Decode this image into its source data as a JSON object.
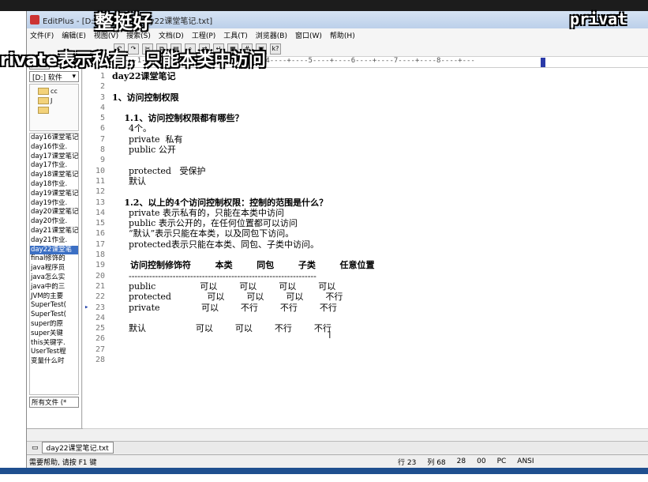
{
  "window": {
    "title": "EditPlus - [D:\\Document\\day22课堂笔记.txt]"
  },
  "menubar": [
    "文件(F)",
    "编辑(E)",
    "视图(V)",
    "搜索(S)",
    "文档(D)",
    "工程(P)",
    "工具(T)",
    "浏览器(B)",
    "窗口(W)",
    "帮助(H)"
  ],
  "toolbar": {
    "help_label": "k?"
  },
  "sidebar": {
    "tab_label": "目录",
    "drive": "[D:] 软件",
    "folders": [
      "cc",
      "J",
      ""
    ],
    "files": [
      {
        "name": "day16课堂笔记"
      },
      {
        "name": "day16作业."
      },
      {
        "name": "day17课堂笔记"
      },
      {
        "name": "day17作业."
      },
      {
        "name": "day18课堂笔记"
      },
      {
        "name": "day18作业."
      },
      {
        "name": "day19课堂笔记"
      },
      {
        "name": "day19作业."
      },
      {
        "name": "day20课堂笔记"
      },
      {
        "name": "day20作业."
      },
      {
        "name": "day21课堂笔记"
      },
      {
        "name": "day21作业."
      },
      {
        "name": "day22课堂笔"
      },
      {
        "name": "final修饰的"
      },
      {
        "name": "java程序员"
      },
      {
        "name": "java怎么实"
      },
      {
        "name": "java中的三"
      },
      {
        "name": "JVM的主要"
      },
      {
        "name": "SuperTest("
      },
      {
        "name": "SuperTest("
      },
      {
        "name": "super的原"
      },
      {
        "name": "super关键"
      },
      {
        "name": "this关键字."
      },
      {
        "name": "UserTest程"
      },
      {
        "name": "变量什么时"
      }
    ],
    "selected_index": 12,
    "filter": "所有文件 (*"
  },
  "ruler": "----+----1----+----2----+----3----+----4----+----5----+----6----+----7----+----8----+---",
  "lines": [
    "day22课堂笔记",
    "",
    "1、访问控制权限",
    "",
    "    1.1、访问控制权限都有哪些？",
    "      4个。",
    "      private  私有",
    "      public 公开",
    "",
    "      protected   受保护",
    "      默认",
    "",
    "    1.2、以上的4个访问控制权限：控制的范围是什么？",
    "      private 表示私有的，只能在本类中访问",
    "      public 表示公开的，在任何位置都可以访问",
    "      “默认”表示只能在本类，以及同包下访问。",
    "      protected表示只能在本类、同包、子类中访问。",
    "",
    "      访问控制修饰符        本类        同包        子类        任意位置",
    "      ----------------------------------------------------------------",
    "      public                可以        可以        可以        可以",
    "      protected             可以        可以        可以        不行",
    "      private               可以        不行        不行        不行",
    "",
    "      默认                  可以        可以        不行        不行",
    "",
    "",
    ""
  ],
  "current_line": 23,
  "doc_tab": "day22课堂笔记.txt",
  "status": {
    "help": "需要帮助, 请按 F1 键",
    "line": "行 23",
    "col": "列 68",
    "n1": "28",
    "n2": "00",
    "mode": "PC",
    "encoding": "ANSI"
  },
  "captions": {
    "top": "整挺好",
    "subtitle": "rivate表示私有，只能本类中访问",
    "right": "privat"
  }
}
